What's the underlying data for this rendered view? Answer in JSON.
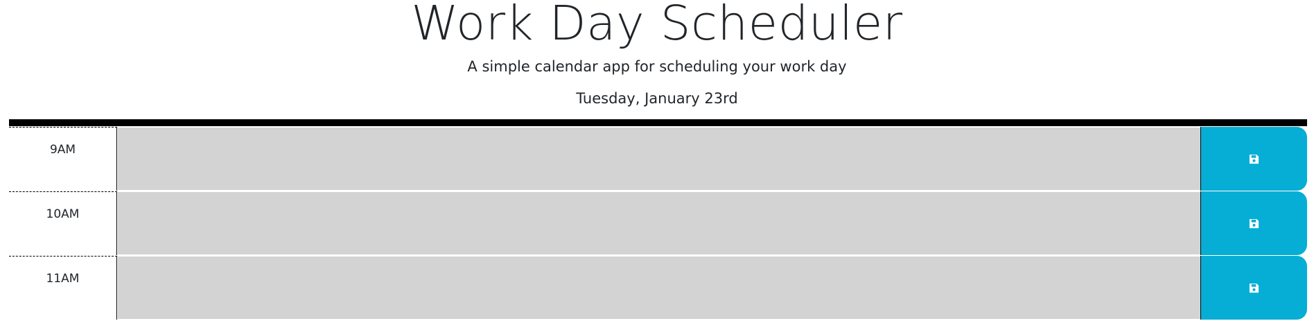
{
  "header": {
    "title": "Work Day Scheduler",
    "subtitle": "A simple calendar app for scheduling your work day",
    "current_date": "Tuesday, January 23rd"
  },
  "colors": {
    "past": "#d3d3d3",
    "save_button": "#06aed5",
    "divider": "#000000"
  },
  "time_blocks": [
    {
      "hour": "9AM",
      "description": "",
      "status": "past",
      "save_icon": "save-icon"
    },
    {
      "hour": "10AM",
      "description": "",
      "status": "past",
      "save_icon": "save-icon"
    },
    {
      "hour": "11AM",
      "description": "",
      "status": "past",
      "save_icon": "save-icon"
    }
  ]
}
